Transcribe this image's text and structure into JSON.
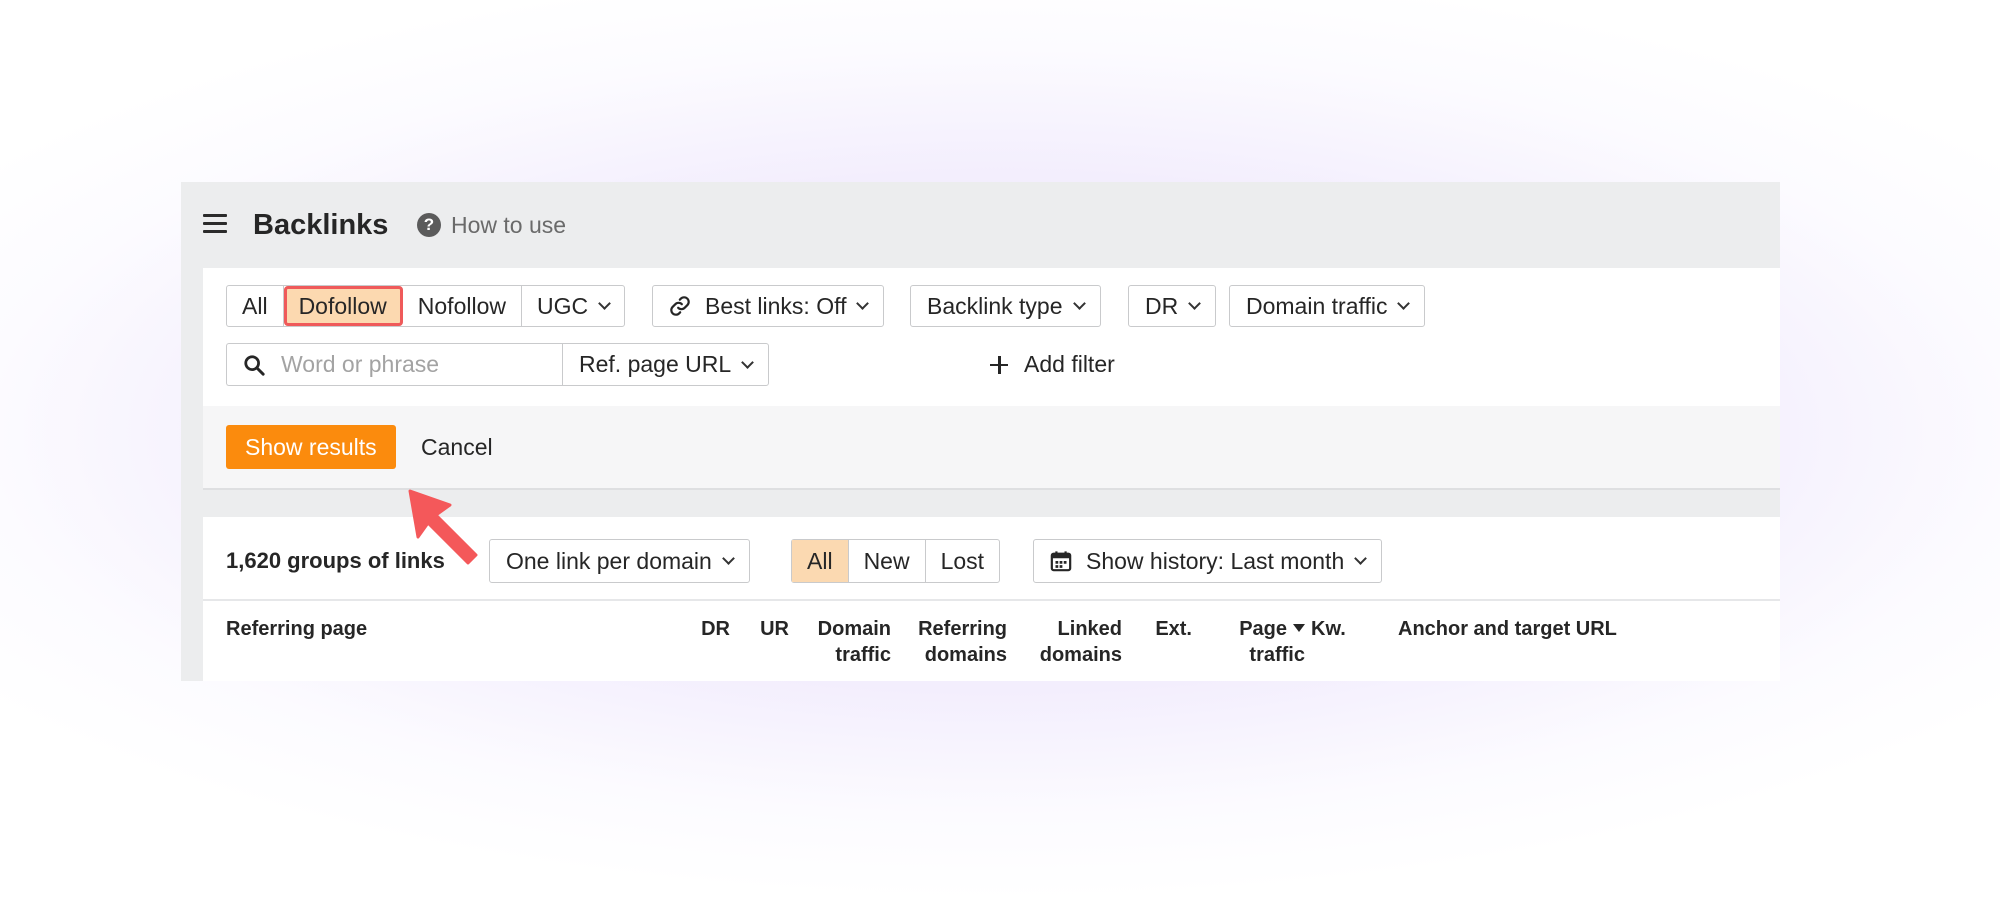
{
  "header": {
    "title": "Backlinks",
    "help_label": "How to use"
  },
  "filters": {
    "link_type_tabs": [
      {
        "label": "All"
      },
      {
        "label": "Dofollow",
        "state": "highlighted"
      },
      {
        "label": "Nofollow"
      },
      {
        "label": "UGC"
      }
    ],
    "best_links_label": "Best links: Off",
    "backlink_type_label": "Backlink type",
    "dr_label": "DR",
    "domain_traffic_label": "Domain traffic",
    "search_placeholder": "Word or phrase",
    "search_value": "",
    "ref_page_url_label": "Ref. page URL",
    "add_filter_label": "Add filter"
  },
  "actions": {
    "show_results_label": "Show results",
    "cancel_label": "Cancel"
  },
  "results": {
    "count_label": "1,620 groups of links",
    "grouping_label": "One link per domain",
    "status_tabs": [
      {
        "label": "All",
        "active": true
      },
      {
        "label": "New"
      },
      {
        "label": "Lost"
      }
    ],
    "history_label": "Show history: Last month"
  },
  "table": {
    "columns": [
      {
        "line1": "Referring page",
        "line2": ""
      },
      {
        "line1": "DR",
        "line2": ""
      },
      {
        "line1": "UR",
        "line2": ""
      },
      {
        "line1": "Domain",
        "line2": "traffic"
      },
      {
        "line1": "Referring",
        "line2": "domains"
      },
      {
        "line1": "Linked",
        "line2": "domains"
      },
      {
        "line1": "Ext.",
        "line2": ""
      },
      {
        "line1": "Page",
        "line2": "traffic",
        "sorted": "desc"
      },
      {
        "line1": "Kw.",
        "line2": ""
      },
      {
        "line1": "Anchor and target URL",
        "line2": ""
      }
    ]
  },
  "colors": {
    "accent_orange": "#fb8b0d",
    "selected_tab_bg": "#fcd9b0",
    "highlight_outline": "#ef5a5a",
    "annotation_arrow": "#f4585a",
    "header_bg": "#ecedee",
    "panel_bg": "#ffffff"
  },
  "icons": {
    "menu": "hamburger-icon",
    "help": "question-circle-icon",
    "best_links": "link-icon",
    "search": "magnifier-icon",
    "add_filter": "plus-icon",
    "history": "calendar-icon",
    "sort": "sort-desc-icon",
    "annotation": "annotation-arrow-icon"
  }
}
